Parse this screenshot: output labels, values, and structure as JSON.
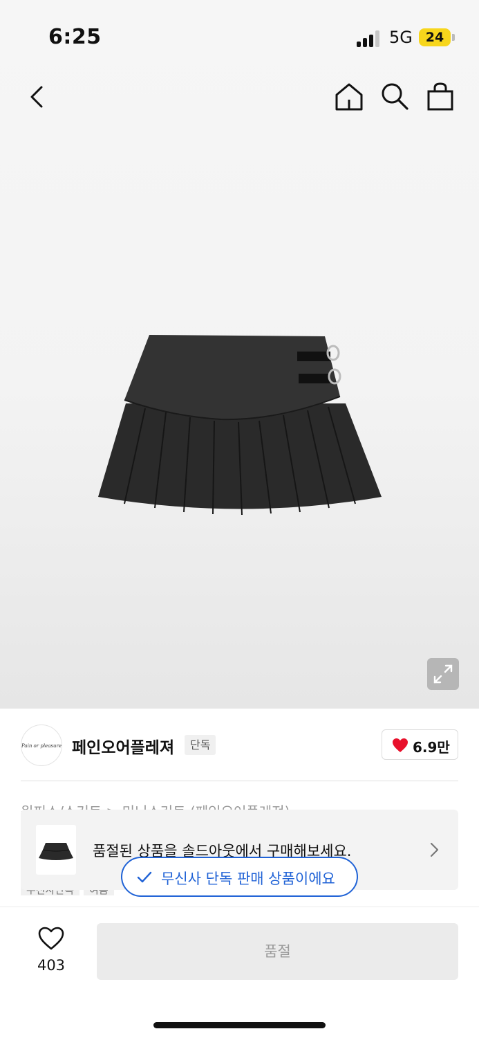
{
  "status_bar": {
    "time": "6:25",
    "network": "5G",
    "battery": "24"
  },
  "nav": {
    "back_icon": "chevron-left-icon",
    "home_icon": "home-icon",
    "search_icon": "search-icon",
    "bag_icon": "shopping-bag-icon"
  },
  "product": {
    "image_alt": "pleated mini skirt with buckle straps",
    "expand_icon": "expand-icon"
  },
  "brand": {
    "logo_text": "Pain or pleasure",
    "name": "페인오어플레져",
    "tag": "단독",
    "likes": "6.9만",
    "heart_color": "#e8102b"
  },
  "category_peek": "원피스/스커트 > 미니스커트 (페인오어플레져)",
  "tags_peek": [
    "무신사단독",
    "여름"
  ],
  "soldout_banner": {
    "text": "품절된 상품을 솔드아웃에서 구매해보세요."
  },
  "exclusive_pill": {
    "label": "무신사 단독 판매 상품이에요",
    "color": "#1f62d6"
  },
  "bottom_bar": {
    "wish_count": "403",
    "buy_label": "품절"
  }
}
